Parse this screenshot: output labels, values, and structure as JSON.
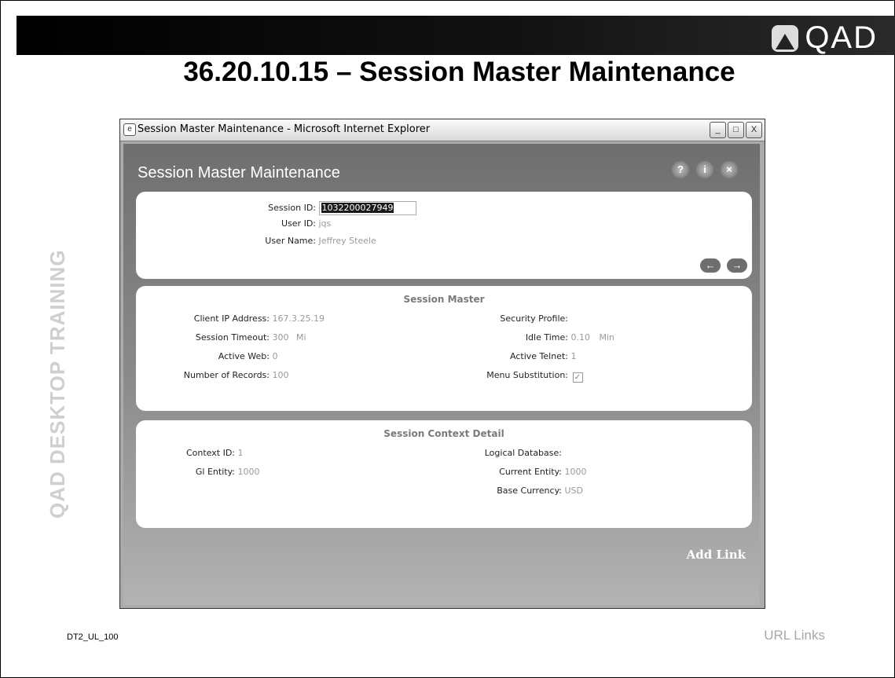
{
  "slide": {
    "title": "36.20.10.15 – Session Master Maintenance",
    "logo_text": "QAD",
    "watermark": "QAD DESKTOP TRAINING",
    "footer_code": "DT2_UL_100",
    "footer_topic": "URL Links"
  },
  "window": {
    "title": "Session Master Maintenance - Microsoft Internet Explorer",
    "buttons": {
      "minimize": "_",
      "maximize": "□",
      "close": "X"
    }
  },
  "app": {
    "title": "Session Master Maintenance",
    "header_buttons": {
      "help": "?",
      "info": "i",
      "close": "×"
    }
  },
  "session": {
    "session_id_label": "Session ID:",
    "session_id_value": "1032200027949",
    "user_id_label": "User ID:",
    "user_id_value": "jqs",
    "user_name_label": "User Name:",
    "user_name_value": "Jeffrey Steele"
  },
  "session_master": {
    "heading": "Session Master",
    "client_ip_label": "Client IP Address:",
    "client_ip_value": "167.3.25.19",
    "security_profile_label": "Security Profile:",
    "session_timeout_label": "Session Timeout:",
    "session_timeout_value": "300",
    "session_timeout_unit": "Mi",
    "idle_time_label": "Idle Time:",
    "idle_time_value": "0.10",
    "idle_time_unit": "Min",
    "active_web_label": "Active Web:",
    "active_web_value": "0",
    "active_telnet_label": "Active Telnet:",
    "active_telnet_value": "1",
    "num_records_label": "Number of Records:",
    "num_records_value": "100",
    "menu_substitution_label": "Menu Substitution:",
    "menu_substitution_checked": true
  },
  "context_detail": {
    "heading": "Session Context Detail",
    "context_id_label": "Context ID:",
    "context_id_value": "1",
    "logical_db_label": "Logical Database:",
    "gl_entity_label": "Gl Entity:",
    "gl_entity_value": "1000",
    "current_entity_label": "Current Entity:",
    "current_entity_value": "1000",
    "base_currency_label": "Base Currency:",
    "base_currency_value": "USD"
  },
  "footer": {
    "add_link_label": "Add Link"
  },
  "icons": {
    "window_icon": "ie-page-icon",
    "prev": "left-arrow-icon",
    "next": "right-arrow-icon",
    "checkbox_mark": "✓"
  }
}
